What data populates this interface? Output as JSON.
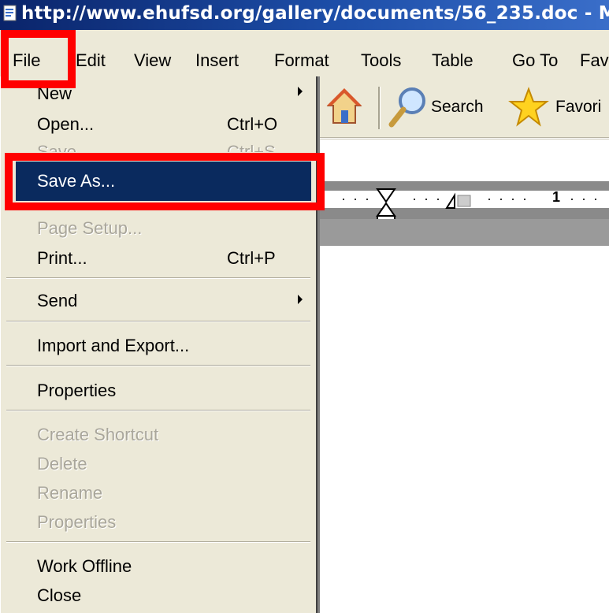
{
  "window": {
    "title": "http://www.ehufsd.org/gallery/documents/56_235.doc - M"
  },
  "menubar": {
    "items": [
      "File",
      "Edit",
      "View",
      "Insert",
      "Format",
      "Tools",
      "Table",
      "Go To",
      "Fav"
    ]
  },
  "toolbar": {
    "search_label": "Search",
    "favorites_label": "Favori",
    "icons": [
      "home-icon",
      "search-icon",
      "favorites-star-icon"
    ]
  },
  "ruler": {
    "mark": "1"
  },
  "file_menu": {
    "items": [
      {
        "label": "New",
        "shortcut": "",
        "enabled": true,
        "submenu": true
      },
      {
        "label": "Open...",
        "shortcut": "Ctrl+O",
        "enabled": true
      },
      {
        "label": "Save",
        "shortcut": "Ctrl+S",
        "enabled": false
      },
      {
        "label": "Save As...",
        "shortcut": "",
        "enabled": true,
        "selected": true
      },
      {
        "label": "Page Setup...",
        "shortcut": "",
        "enabled": false
      },
      {
        "label": "Print...",
        "shortcut": "Ctrl+P",
        "enabled": true
      },
      {
        "label": "Send",
        "shortcut": "",
        "enabled": true,
        "submenu": true
      },
      {
        "label": "Import and Export...",
        "shortcut": "",
        "enabled": true
      },
      {
        "label": "Properties",
        "shortcut": "",
        "enabled": true
      },
      {
        "label": "Create Shortcut",
        "shortcut": "",
        "enabled": false
      },
      {
        "label": "Delete",
        "shortcut": "",
        "enabled": false
      },
      {
        "label": "Rename",
        "shortcut": "",
        "enabled": false
      },
      {
        "label": "Properties",
        "shortcut": "",
        "enabled": false
      },
      {
        "label": "Work Offline",
        "shortcut": "",
        "enabled": true
      },
      {
        "label": "Close",
        "shortcut": "",
        "enabled": true
      }
    ]
  },
  "colors": {
    "title_bar": "#0a246a",
    "menu_bg": "#ece9d8",
    "highlight": "#0a2a5e",
    "annotation": "#ff0000"
  }
}
